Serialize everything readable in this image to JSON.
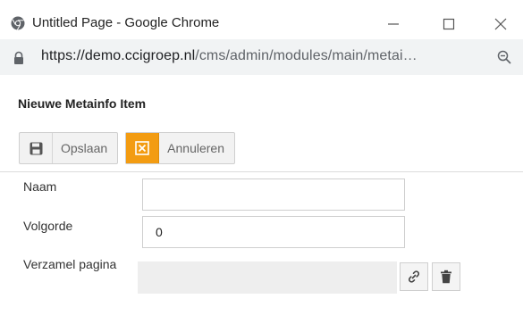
{
  "window": {
    "title": "Untitled Page - Google Chrome",
    "minimize_icon": "minimize-icon",
    "maximize_icon": "maximize-icon",
    "close_icon": "close-icon"
  },
  "address_bar": {
    "url_host": "https://demo.ccigroep.nl",
    "url_path": "/cms/admin/modules/main/metai…",
    "lock_icon": "lock-icon",
    "zoom_icon": "zoom-icon"
  },
  "page": {
    "title": "Nieuwe Metainfo Item"
  },
  "toolbar": {
    "save_label": "Opslaan",
    "save_icon": "floppy-disk-icon",
    "cancel_label": "Annuleren",
    "cancel_icon": "cancel-x-icon",
    "cancel_color": "#f39c12"
  },
  "form": {
    "naam_label": "Naam",
    "naam_value": "",
    "volgorde_label": "Volgorde",
    "volgorde_value": "0",
    "verzamel_label": "Verzamel pagina",
    "link_icon": "link-icon",
    "trash_icon": "trash-icon"
  }
}
